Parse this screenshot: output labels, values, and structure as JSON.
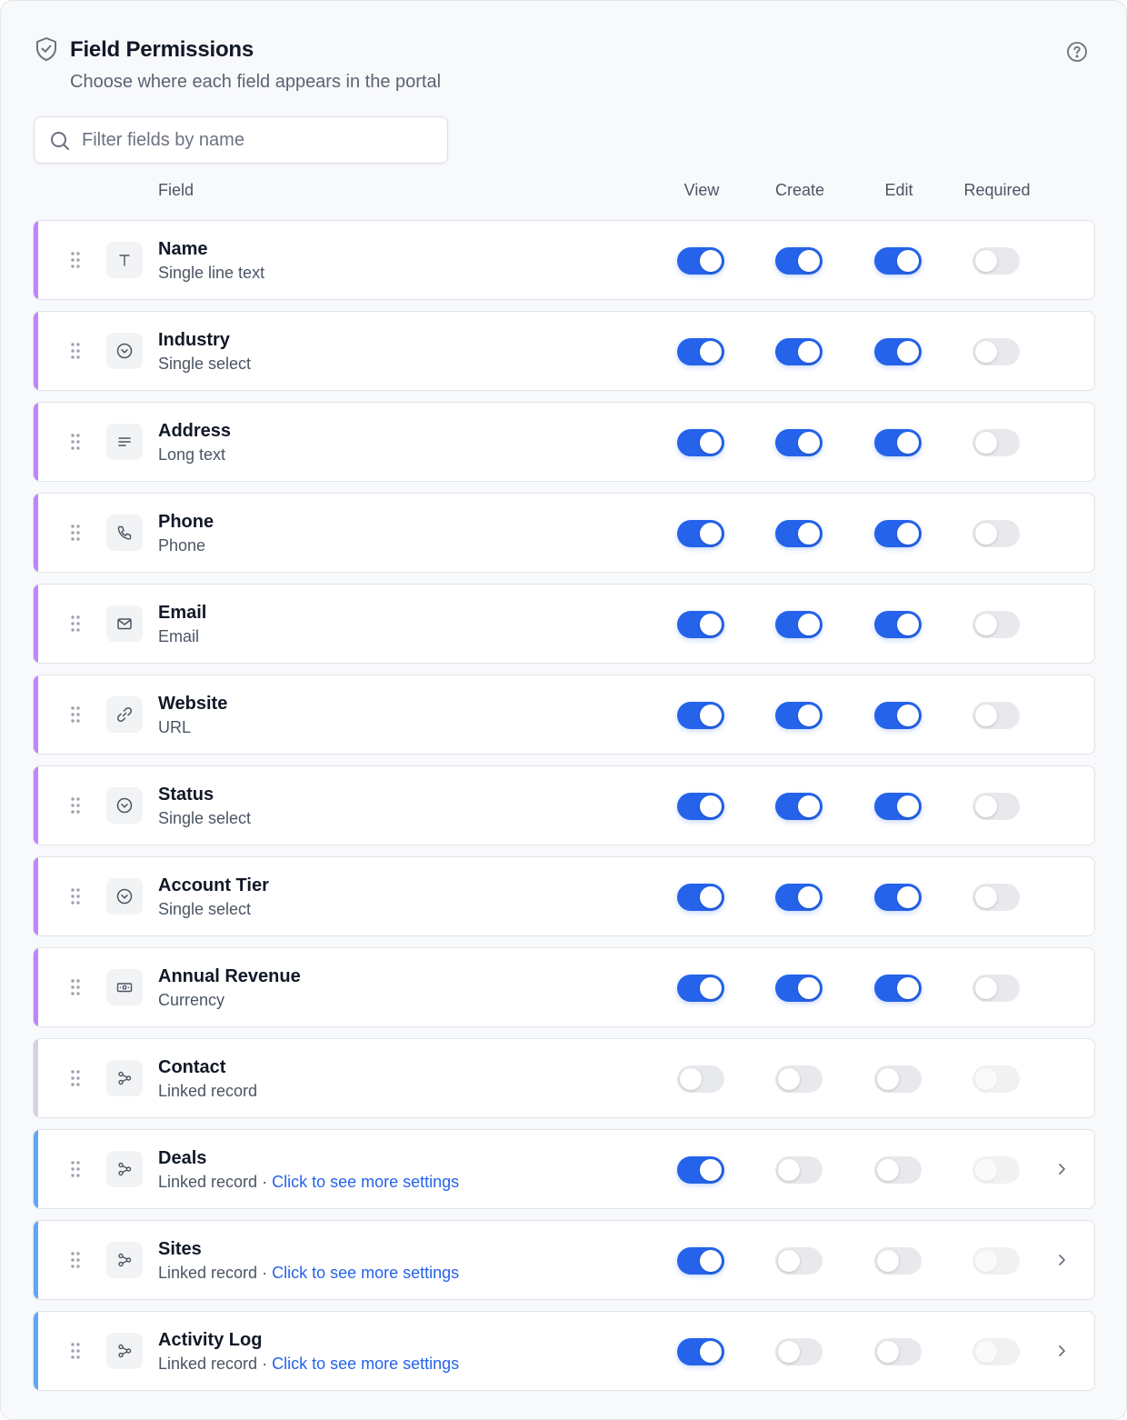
{
  "header": {
    "title": "Field Permissions",
    "subtitle": "Choose where each field appears in the portal",
    "shield_icon": "shield-check-icon",
    "help_icon": "help-circle-icon"
  },
  "search": {
    "placeholder": "Filter fields by name",
    "value": "",
    "icon": "search-icon"
  },
  "columns": {
    "field": "Field",
    "view": "View",
    "create": "Create",
    "edit": "Edit",
    "required": "Required"
  },
  "colors": {
    "toggle_on": "#2563eb",
    "link": "#2563eb",
    "accent_purple": "#c084fc",
    "accent_gray": "#d1d5db",
    "accent_blue": "#60a5fa"
  },
  "rows": [
    {
      "name": "Name",
      "type": "Single line text",
      "icon": "text-icon",
      "accent": "purple",
      "view": true,
      "create": true,
      "edit": true,
      "required": false,
      "required_disabled": false,
      "has_settings": false
    },
    {
      "name": "Industry",
      "type": "Single select",
      "icon": "single-select-icon",
      "accent": "purple",
      "view": true,
      "create": true,
      "edit": true,
      "required": false,
      "required_disabled": false,
      "has_settings": false
    },
    {
      "name": "Address",
      "type": "Long text",
      "icon": "long-text-icon",
      "accent": "purple",
      "view": true,
      "create": true,
      "edit": true,
      "required": false,
      "required_disabled": false,
      "has_settings": false
    },
    {
      "name": "Phone",
      "type": "Phone",
      "icon": "phone-icon",
      "accent": "purple",
      "view": true,
      "create": true,
      "edit": true,
      "required": false,
      "required_disabled": false,
      "has_settings": false
    },
    {
      "name": "Email",
      "type": "Email",
      "icon": "email-icon",
      "accent": "purple",
      "view": true,
      "create": true,
      "edit": true,
      "required": false,
      "required_disabled": false,
      "has_settings": false
    },
    {
      "name": "Website",
      "type": "URL",
      "icon": "link-icon",
      "accent": "purple",
      "view": true,
      "create": true,
      "edit": true,
      "required": false,
      "required_disabled": false,
      "has_settings": false
    },
    {
      "name": "Status",
      "type": "Single select",
      "icon": "single-select-icon",
      "accent": "purple",
      "view": true,
      "create": true,
      "edit": true,
      "required": false,
      "required_disabled": false,
      "has_settings": false
    },
    {
      "name": "Account Tier",
      "type": "Single select",
      "icon": "single-select-icon",
      "accent": "purple",
      "view": true,
      "create": true,
      "edit": true,
      "required": false,
      "required_disabled": false,
      "has_settings": false
    },
    {
      "name": "Annual Revenue",
      "type": "Currency",
      "icon": "currency-icon",
      "accent": "purple",
      "view": true,
      "create": true,
      "edit": true,
      "required": false,
      "required_disabled": false,
      "has_settings": false
    },
    {
      "name": "Contact",
      "type": "Linked record",
      "icon": "linked-record-icon",
      "accent": "gray",
      "view": false,
      "create": false,
      "edit": false,
      "required": false,
      "required_disabled": true,
      "has_settings": false
    },
    {
      "name": "Deals",
      "type": "Linked record",
      "icon": "linked-record-icon",
      "accent": "blue",
      "view": true,
      "create": false,
      "edit": false,
      "required": false,
      "required_disabled": true,
      "has_settings": true,
      "settings_link": "Click to see more settings"
    },
    {
      "name": "Sites",
      "type": "Linked record",
      "icon": "linked-record-icon",
      "accent": "blue",
      "view": true,
      "create": false,
      "edit": false,
      "required": false,
      "required_disabled": true,
      "has_settings": true,
      "settings_link": "Click to see more settings"
    },
    {
      "name": "Activity Log",
      "type": "Linked record",
      "icon": "linked-record-icon",
      "accent": "blue",
      "view": true,
      "create": false,
      "edit": false,
      "required": false,
      "required_disabled": true,
      "has_settings": true,
      "settings_link": "Click to see more settings"
    }
  ]
}
